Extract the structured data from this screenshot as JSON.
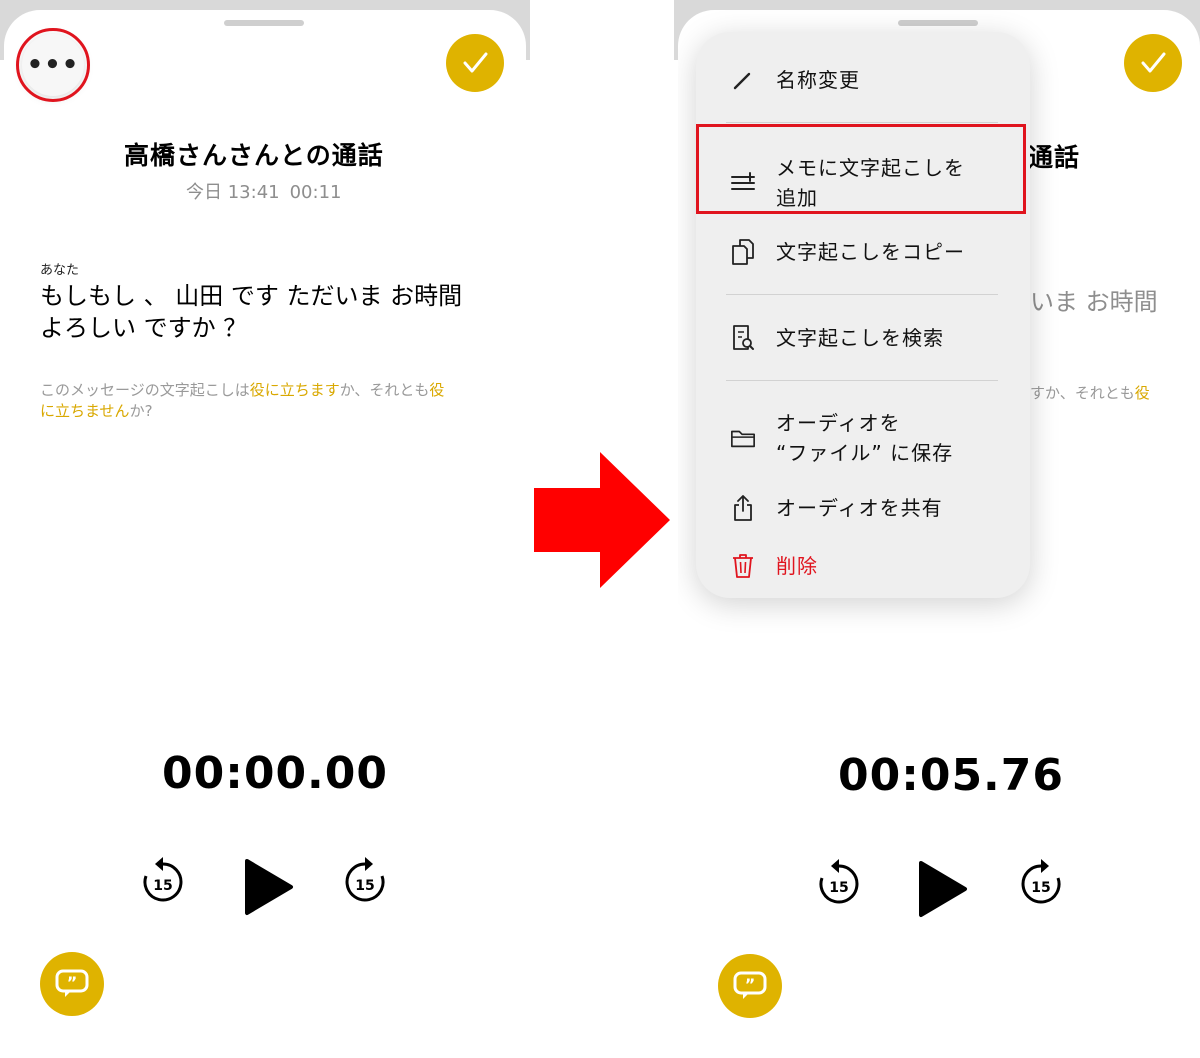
{
  "colors": {
    "accent": "#dfb300",
    "highlight_red": "#e0141e",
    "arrow_red": "#ff0000"
  },
  "left": {
    "more_icon": "ellipsis-icon",
    "done_icon": "checkmark-icon",
    "title": "高橋さんさんとの通話",
    "date": "今日 13:41",
    "duration": "00:11",
    "speaker": "あなた",
    "transcript_line1": "もしもし 、 山田 です ただいま お時間",
    "transcript_line2": "よろしい ですか ？",
    "feedback_pre": "このメッセージの文字起こしは",
    "feedback_helpful": "役に立ちます",
    "feedback_mid": "か、それとも",
    "feedback_not_a": "役",
    "feedback_not_b": "に立ちません",
    "feedback_post": "か?",
    "timer": "00:00.00",
    "skip_back_label": "15",
    "skip_fwd_label": "15"
  },
  "right": {
    "menu": {
      "rename": "名称変更",
      "add_to_notes_line1": "メモに文字起こしを",
      "add_to_notes_line2": "追加",
      "copy_transcript": "文字起こしをコピー",
      "search_transcript": "文字起こしを検索",
      "save_audio_line1": "オーディオを",
      "save_audio_line2": "“ファイル” に保存",
      "share_audio": "オーディオを共有",
      "delete": "削除"
    },
    "peek_title": "通話",
    "peek_text": "いま お時間",
    "peek_fb_pre": "すか、それとも",
    "peek_fb_hl": "役",
    "timer": "00:05.76",
    "skip_back_label": "15",
    "skip_fwd_label": "15"
  }
}
